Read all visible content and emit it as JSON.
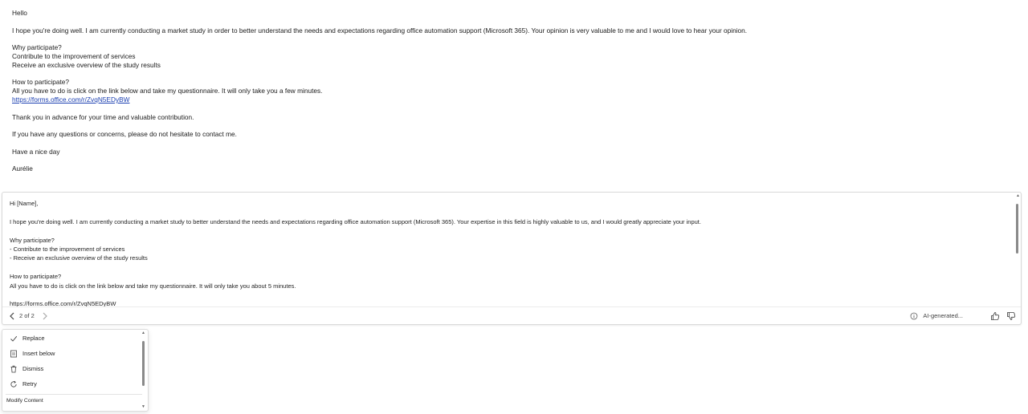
{
  "email": {
    "greeting": "Hello",
    "intro": "I hope you're doing well. I am currently conducting a market study in order to better understand the needs and expectations regarding office automation support (Microsoft 365). Your opinion is very valuable to me and I would love to hear your opinion.",
    "why_heading": "Why participate?",
    "why_items": [
      "Contribute to the improvement of services",
      "Receive an exclusive overview of the study results"
    ],
    "how_heading": "How to participate?",
    "how_text": "All you have to do is click on the link below and take my questionnaire. It will only take you a few minutes.",
    "link": "https://forms.office.com/r/ZvqN5EDyBW",
    "thanks": "Thank you in advance for your time and valuable contribution.",
    "questions": "If you have any questions or concerns, please do not hesitate to contact me.",
    "closing": "Have a nice day",
    "signature": "Aurélie"
  },
  "suggestion": {
    "greeting": "Hi [Name],",
    "intro": "I hope you're doing well. I am currently conducting a market study to better understand the needs and expectations regarding office automation support (Microsoft 365). Your expertise in this field is highly valuable to us, and I would greatly appreciate your input.",
    "why_heading": "Why participate?",
    "why_items": [
      "- Contribute to the improvement of services",
      "- Receive an exclusive overview of the study results"
    ],
    "how_heading": "How to participate?",
    "how_text": "All you have to do is click on the link below and take my questionnaire. It will only take you about 5 minutes.",
    "link": "https://forms.office.com/r/ZvqN5EDyBW",
    "pager": "2 of 2",
    "ai_label": "AI-generated..."
  },
  "menu": {
    "items": [
      {
        "label": "Replace",
        "icon": "checkmark-icon"
      },
      {
        "label": "Insert below",
        "icon": "insert-below-icon"
      },
      {
        "label": "Dismiss",
        "icon": "trash-icon"
      },
      {
        "label": "Retry",
        "icon": "retry-icon"
      }
    ],
    "footer": "Modify Content"
  },
  "colors": {
    "link": "#1b3fb0",
    "scroll_thumb": "#8a8a8a",
    "border": "#d9d9d9"
  }
}
